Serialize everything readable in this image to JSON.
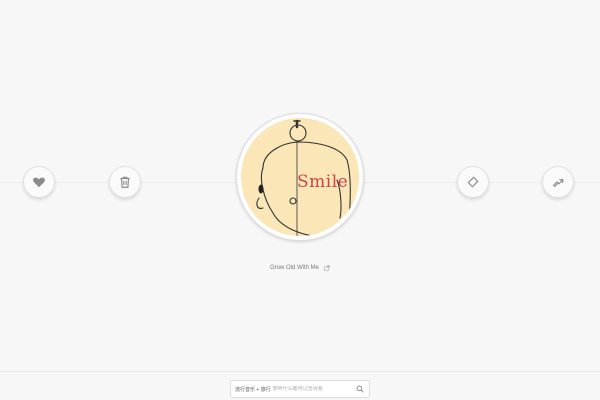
{
  "player": {
    "song_title": "Grow Old With Me",
    "cover_text": "Smile"
  },
  "controls": {
    "like_icon": "heart-icon",
    "trash_icon": "trash-icon",
    "loop_icon": "loop-icon",
    "share_icon": "share-icon"
  },
  "search": {
    "prefix": "流行音乐 + 旅行",
    "placeholder": "想听什么都可以告诉我"
  },
  "colors": {
    "background": "#f7f7f7",
    "cover_bg": "#fbe6b8",
    "icon": "#8a8a8a"
  }
}
